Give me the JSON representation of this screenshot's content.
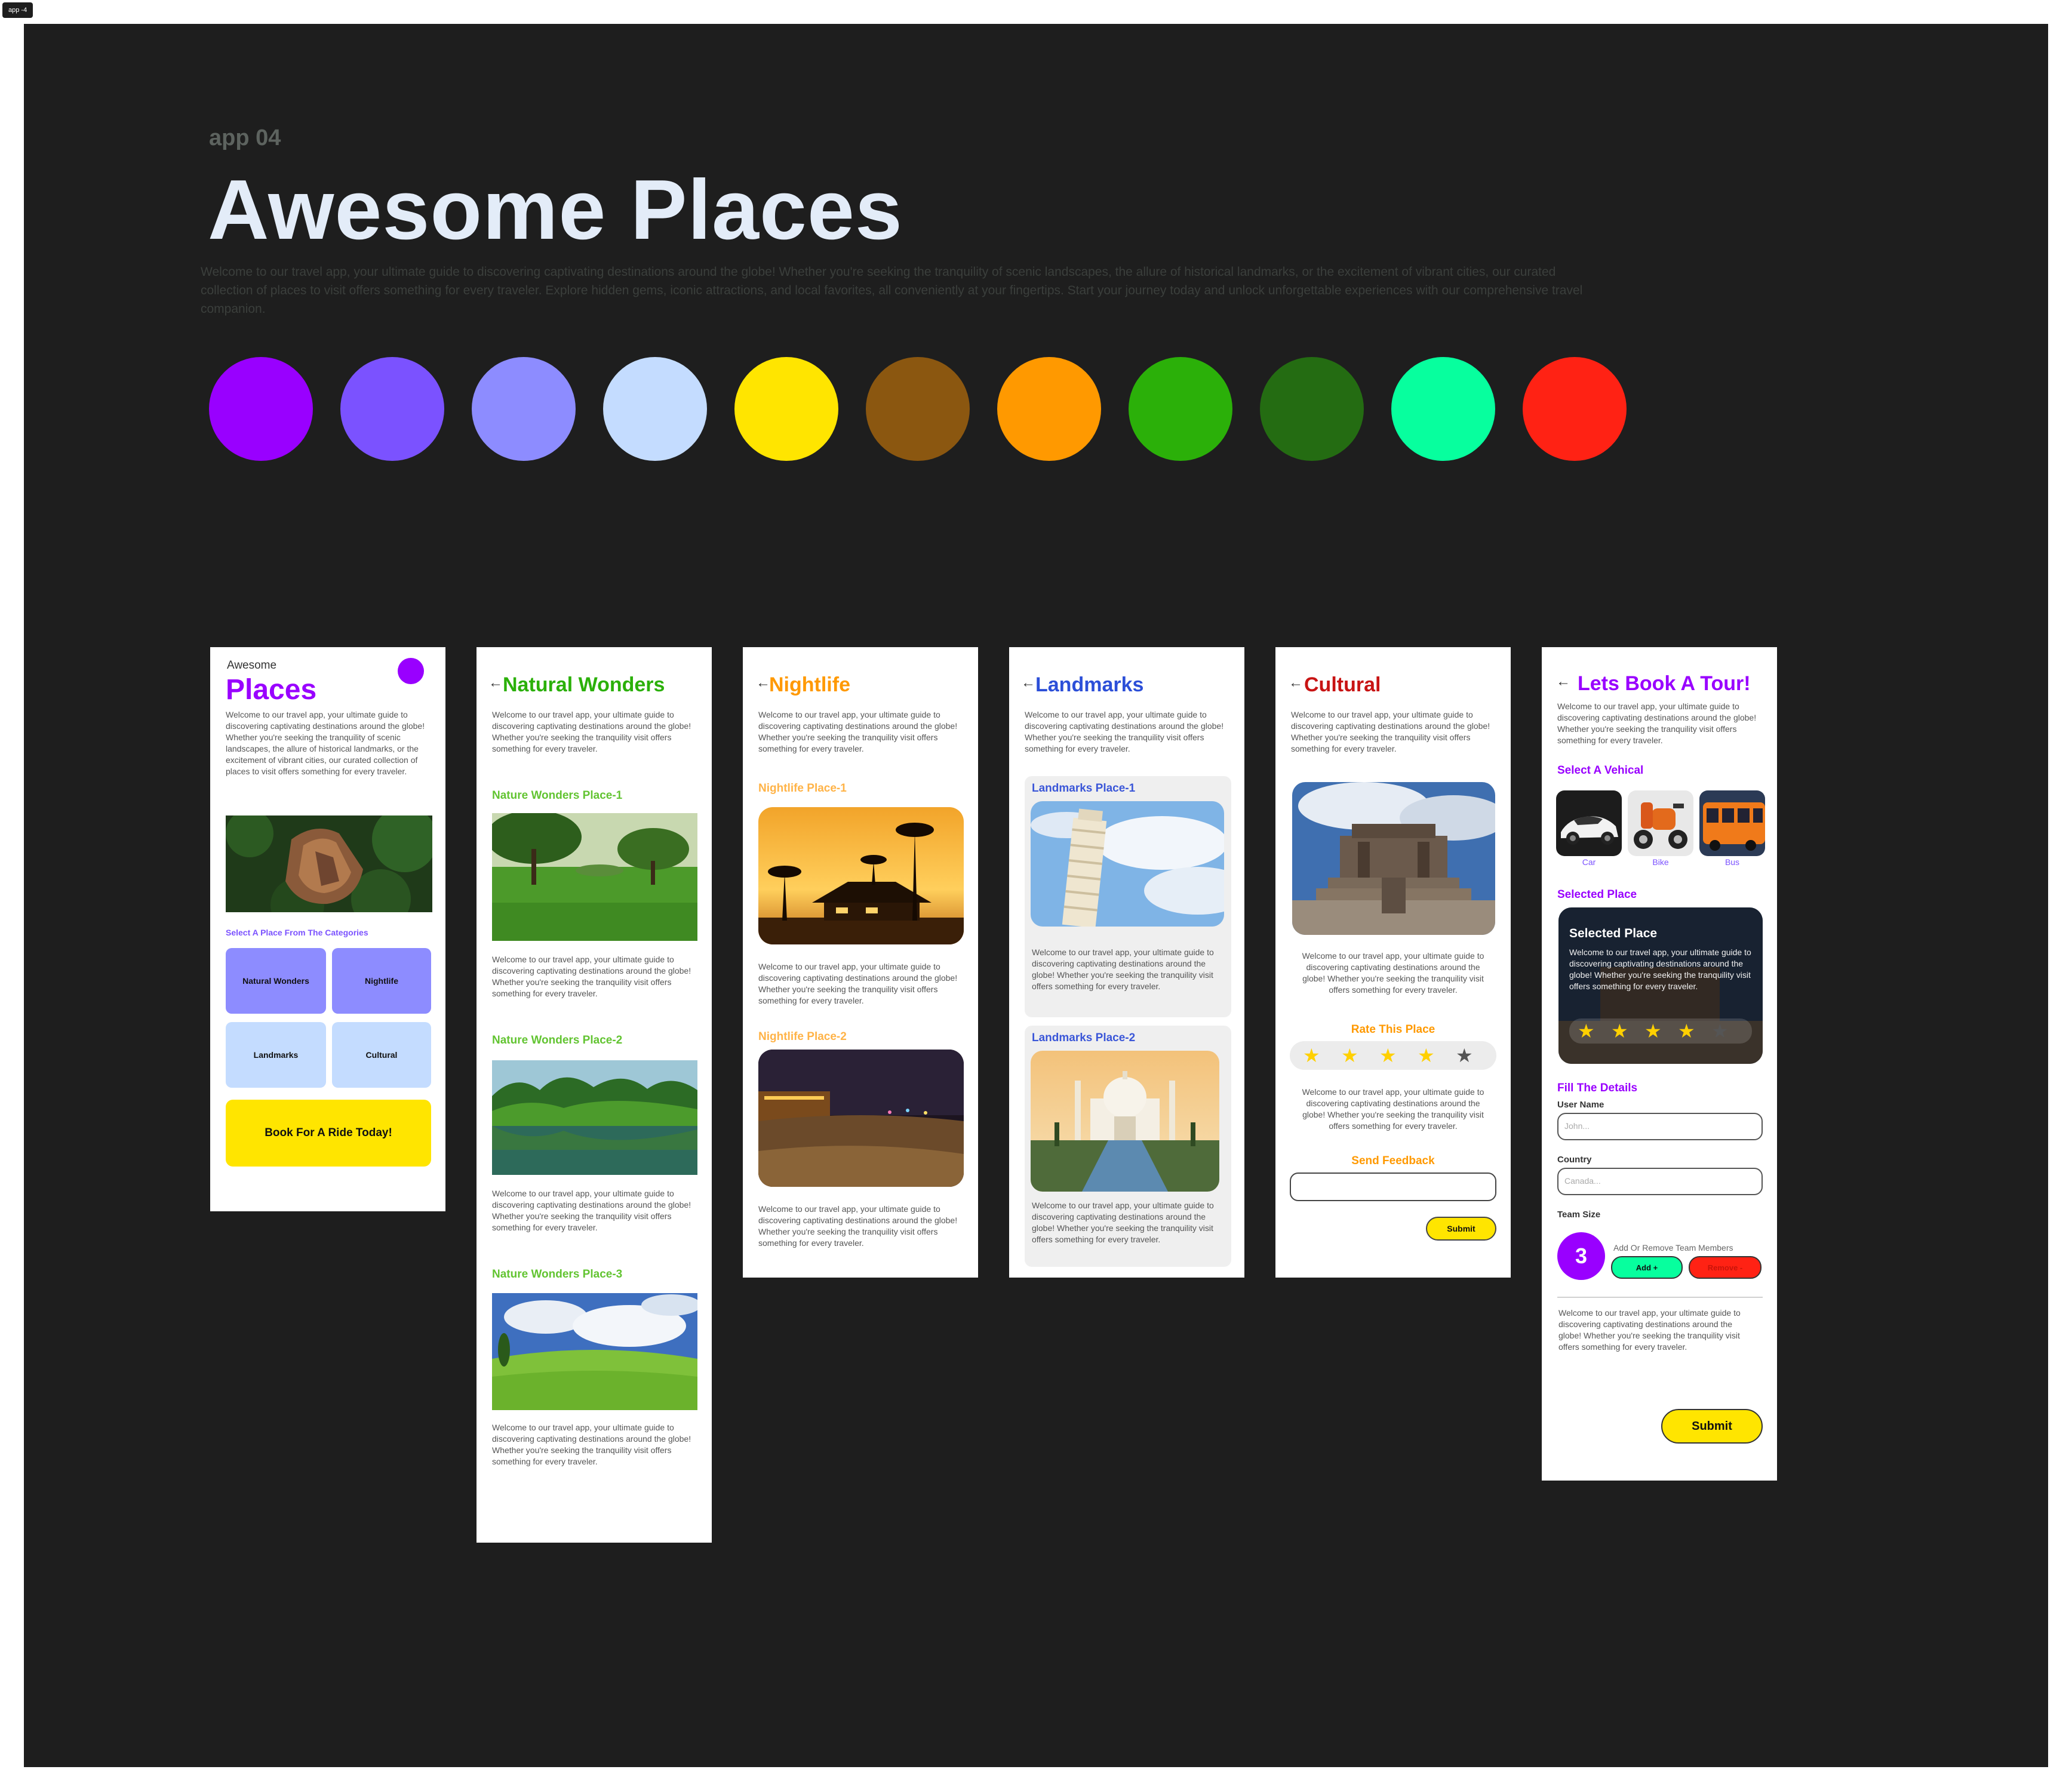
{
  "frame_tag": "app -4",
  "header": {
    "label": "app 04",
    "title": "Awesome Places",
    "intro": "Welcome to our travel app, your ultimate guide to discovering captivating destinations around the globe! Whether you're seeking the tranquility of scenic landscapes, the allure of historical landmarks, or the excitement of vibrant cities, our curated collection of places to visit offers something for every traveler. Explore hidden gems, iconic attractions, and local favorites, all conveniently at your fingertips. Start your journey today and unlock unforgettable experiences with our comprehensive travel companion."
  },
  "palette": [
    "#9900ff",
    "#7b52ff",
    "#8d8cff",
    "#c4dcff",
    "#ffe500",
    "#8b5710",
    "#ff9900",
    "#2bb009",
    "#246c12",
    "#07ff9e",
    "#ff2214"
  ],
  "screen_home": {
    "small_title": "Awesome",
    "title": "Places",
    "intro": "Welcome to our travel app, your ultimate guide to discovering captivating destinations around the globe! Whether you're seeking the tranquility of scenic landscapes, the allure of historical landmarks, or the excitement of vibrant cities, our curated collection of places to visit offers something for every traveler.",
    "category_heading": "Select A Place From The Categories",
    "categories": [
      "Natural Wonders",
      "Nightlife",
      "Landmarks",
      "Cultural"
    ],
    "cta": "Book For A Ride Today!"
  },
  "short_text": "Welcome to our travel app, your ultimate guide to discovering captivating destinations around the globe! Whether you're seeking the tranquility visit offers something for every traveler.",
  "screen_natural": {
    "back": "←",
    "title": "Natural Wonders",
    "places": [
      "Nature Wonders Place-1",
      "Nature Wonders Place-2",
      "Nature Wonders Place-3"
    ]
  },
  "screen_nightlife": {
    "back": "←",
    "title": "Nightlife",
    "places": [
      "Nightlife Place-1",
      "Nightlife Place-2"
    ]
  },
  "screen_landmarks": {
    "back": "←",
    "title": "Landmarks",
    "places": [
      "Landmarks Place-1",
      "Landmarks Place-2"
    ]
  },
  "screen_cultural": {
    "back": "←",
    "title": "Cultural",
    "rate_heading": "Rate This Place",
    "rating": 4,
    "rating_max": 5,
    "feedback_heading": "Send Feedback",
    "submit": "Submit"
  },
  "screen_booking": {
    "back": "←",
    "title": "Lets Book A Tour!",
    "vehicle_heading": "Select A Vehical",
    "vehicles": [
      "Car",
      "Bike",
      "Bus"
    ],
    "selected_heading": "Selected Place",
    "selected_card_title": "Selected Place",
    "rating": 4,
    "rating_max": 5,
    "details_heading": "Fill The Details",
    "username_label": "User Name",
    "username_placeholder": "John...",
    "country_label": "Country",
    "country_placeholder": "Canada...",
    "team_label": "Team Size",
    "team_count": "3",
    "team_hint": "Add Or Remove Team Members",
    "add_label": "Add  +",
    "remove_label": "Remove  -",
    "submit": "Submit"
  }
}
